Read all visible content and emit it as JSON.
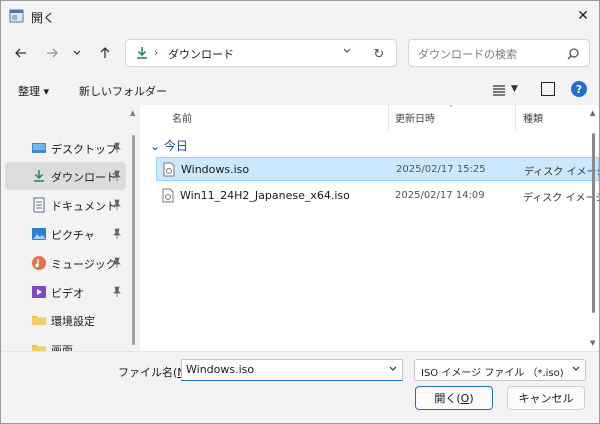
{
  "window": {
    "title": "開く"
  },
  "address": {
    "location": "ダウンロード"
  },
  "search": {
    "placeholder": "ダウンロードの検索"
  },
  "toolbar": {
    "organize_label": "整理 ▾",
    "new_folder_label": "新しいフォルダー",
    "help_label": "?"
  },
  "sidebar": {
    "items": [
      {
        "label": "デスクトップ",
        "icon": "desktop-icon"
      },
      {
        "label": "ダウンロード",
        "icon": "download-icon",
        "selected": true
      },
      {
        "label": "ドキュメント",
        "icon": "document-icon"
      },
      {
        "label": "ピクチャ",
        "icon": "picture-icon"
      },
      {
        "label": "ミュージック",
        "icon": "music-icon"
      },
      {
        "label": "ビデオ",
        "icon": "video-icon"
      },
      {
        "label": "環境設定",
        "icon": "folder-icon"
      },
      {
        "label": "画面",
        "icon": "folder-icon"
      }
    ]
  },
  "list": {
    "columns": {
      "name": "名前",
      "date": "更新日時",
      "type": "種類"
    },
    "group": "今日",
    "files": [
      {
        "name": "Windows.iso",
        "date": "2025/02/17 15:25",
        "type": "ディスク イメージ",
        "selected": true
      },
      {
        "name": "Win11_24H2_Japanese_x64.iso",
        "date": "2025/02/17 14:09",
        "type": "ディスク イメージ"
      }
    ]
  },
  "footer": {
    "filename_label_pre": "ファイル名(",
    "filename_label_key": "N",
    "filename_label_post": "):",
    "filename_value": "Windows.iso",
    "filter_value": "ISO イメージ ファイル （*.iso)",
    "open_pre": "開く(",
    "open_key": "O",
    "open_post": ")",
    "cancel_label": "キャンセル"
  },
  "colors": {
    "accent": "#1f6fd1",
    "selection": "#cce8ff",
    "download_green": "#2e8b57"
  }
}
